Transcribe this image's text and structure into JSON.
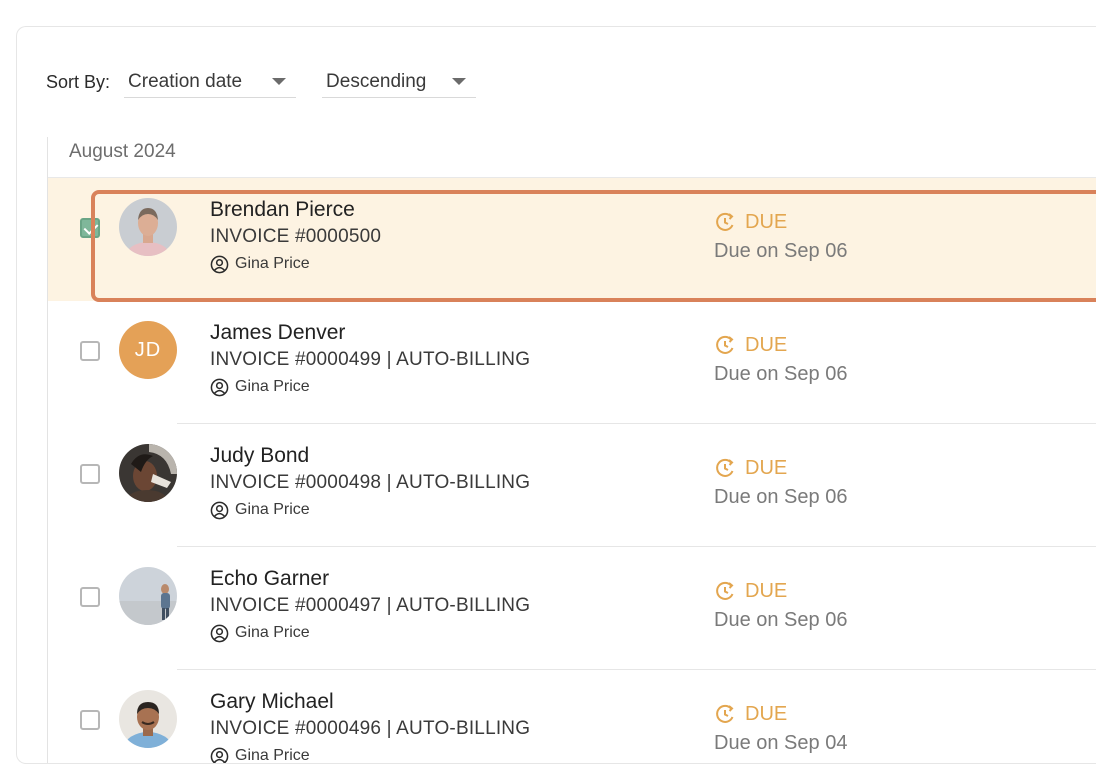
{
  "sort": {
    "label": "Sort By:",
    "field": "Creation date",
    "order": "Descending"
  },
  "group": {
    "title": "August 2024"
  },
  "colors": {
    "accent": "#e3a64f",
    "highlight_border": "#d9825a",
    "selected_bg": "#fdf3e2",
    "checkbox_checked": "#7fb79a",
    "initials_avatar": "#e4a157"
  },
  "invoices": [
    {
      "name": "Brendan Pierce",
      "invoice": "INVOICE #0000500",
      "owner": "Gina Price",
      "status": "DUE",
      "due": "Due on Sep 06",
      "checked": true,
      "avatar": "photo-man-light"
    },
    {
      "name": "James Denver",
      "invoice": "INVOICE #0000499 | AUTO-BILLING",
      "owner": "Gina Price",
      "status": "DUE",
      "due": "Due on Sep 06",
      "checked": false,
      "avatar_initials": "JD"
    },
    {
      "name": "Judy Bond",
      "invoice": "INVOICE #0000498 | AUTO-BILLING",
      "owner": "Gina Price",
      "status": "DUE",
      "due": "Due on Sep 06",
      "checked": false,
      "avatar": "photo-woman-dark"
    },
    {
      "name": "Echo Garner",
      "invoice": "INVOICE #0000497 | AUTO-BILLING",
      "owner": "Gina Price",
      "status": "DUE",
      "due": "Due on Sep 06",
      "checked": false,
      "avatar": "photo-person-outdoor"
    },
    {
      "name": "Gary Michael",
      "invoice": "INVOICE #0000496 | AUTO-BILLING",
      "owner": "Gina Price",
      "status": "DUE",
      "due": "Due on Sep 04",
      "checked": false,
      "avatar": "photo-man-smiling"
    }
  ]
}
